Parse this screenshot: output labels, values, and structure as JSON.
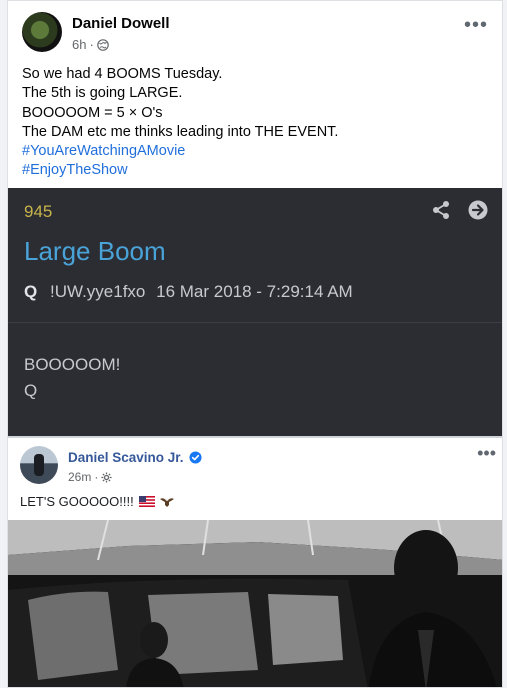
{
  "post": {
    "author": "Daniel Dowell",
    "time": "6h",
    "dot": "·",
    "menu": "•••",
    "lines": [
      "So we had 4 BOOMS Tuesday.",
      "The 5th is going LARGE.",
      "BOOOOOM = 5 × O's",
      "The DAM etc me thinks leading into THE EVENT."
    ],
    "hashtags": [
      "#YouAreWatchingAMovie",
      "#EnjoyTheShow"
    ]
  },
  "qcard": {
    "number": "945",
    "title": "Large Boom",
    "signature": "Q",
    "tripcode": "!UW.yye1fxo",
    "timestamp": "16 Mar 2018 - 7:29:14 AM",
    "body_lines": [
      "BOOOOOM!",
      "Q"
    ],
    "icons": [
      "share-icon",
      "arrow-right-circle-icon"
    ]
  },
  "shared_post": {
    "author": "Daniel Scavino Jr.",
    "time": "26m",
    "dot": "·",
    "menu": "•••",
    "status": "LET'S GOOOOO!!!!",
    "emoji": [
      "us-flag-icon",
      "eagle-icon"
    ]
  },
  "colors": {
    "link_blue": "#216fdb",
    "card_bg": "#2b2d33",
    "q_number": "#c9b44b",
    "q_title": "#4aa3d8",
    "page_author_blue": "#365899"
  }
}
